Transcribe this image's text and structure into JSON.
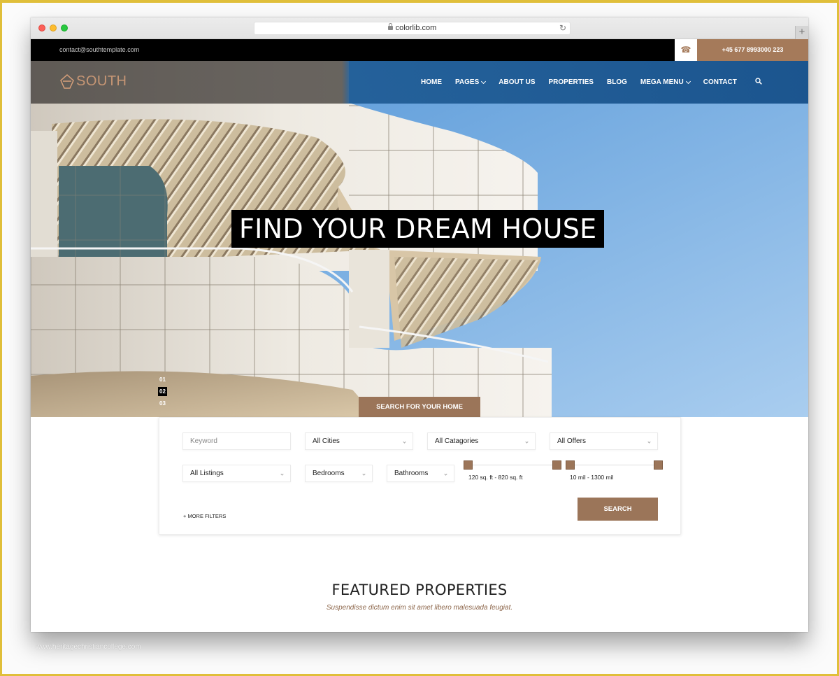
{
  "browser": {
    "url": "colorlib.com",
    "new_tab_label": "+"
  },
  "topbar": {
    "email": "contact@southtemplate.com",
    "phone": "+45 677 8993000 223",
    "accent_color": "#a57a5a"
  },
  "brand": {
    "name": "SOUTH"
  },
  "nav": {
    "items": [
      {
        "label": "HOME",
        "has_dropdown": false
      },
      {
        "label": "PAGES",
        "has_dropdown": true
      },
      {
        "label": "ABOUT US",
        "has_dropdown": false
      },
      {
        "label": "PROPERTIES",
        "has_dropdown": false
      },
      {
        "label": "BLOG",
        "has_dropdown": false
      },
      {
        "label": "MEGA MENU",
        "has_dropdown": true
      },
      {
        "label": "CONTACT",
        "has_dropdown": false
      }
    ]
  },
  "hero": {
    "headline": "FIND YOUR DREAM HOUSE",
    "slides": [
      "01",
      "02",
      "03"
    ],
    "active_slide": "02",
    "cta": "SEARCH FOR YOUR HOME"
  },
  "search": {
    "keyword_placeholder": "Keyword",
    "cities": "All Cities",
    "categories": "All Catagories",
    "offers": "All Offers",
    "listings": "All Listings",
    "bedrooms": "Bedrooms",
    "bathrooms": "Bathrooms",
    "area_range": {
      "label": "120 sq. ft - 820 sq. ft",
      "min": 120,
      "max": 820
    },
    "price_range": {
      "label": "10 mil - 1300 mil",
      "min": 10,
      "max": 1300
    },
    "more_filters": "+ MORE FILTERS",
    "submit": "SEARCH"
  },
  "featured": {
    "title": "FEATURED PROPERTIES",
    "subtitle": "Suspendisse dictum enim sit amet libero malesuada feugiat."
  },
  "watermark": "www.heritagechristiancollege.com"
}
